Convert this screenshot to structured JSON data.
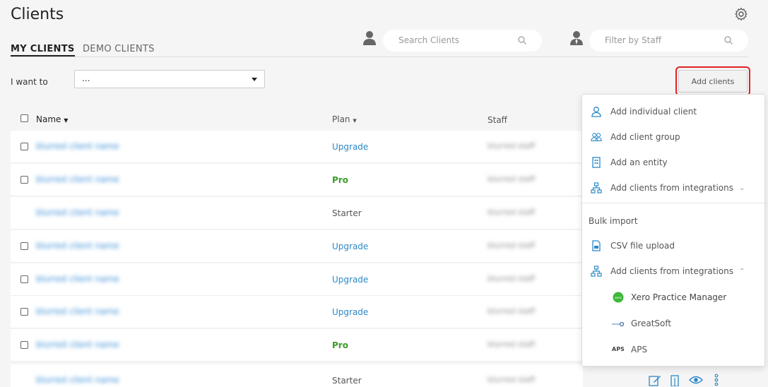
{
  "page": {
    "title": "Clients"
  },
  "tabs": [
    {
      "label": "MY CLIENTS",
      "active": true
    },
    {
      "label": "DEMO CLIENTS",
      "active": false
    }
  ],
  "search": {
    "placeholder": "Search Clients"
  },
  "staff_filter": {
    "placeholder": "Filter by Staff"
  },
  "toolbar": {
    "i_want_to_label": "I want to",
    "i_want_to_value": "...",
    "add_clients_label": "Add clients"
  },
  "table": {
    "columns": {
      "name": "Name",
      "plan": "Plan",
      "staff": "Staff"
    },
    "rows": [
      {
        "name": "blurred client name",
        "plan": "Upgrade",
        "staff": "blurred staff",
        "checkbox": true
      },
      {
        "name": "blurred client name",
        "plan": "Pro",
        "staff": "blurred staff",
        "checkbox": true
      },
      {
        "name": "blurred client name",
        "plan": "Starter",
        "staff": "blurred staff",
        "checkbox": false
      },
      {
        "name": "blurred client name",
        "plan": "Upgrade",
        "staff": "blurred staff",
        "checkbox": true
      },
      {
        "name": "blurred client name",
        "plan": "Upgrade",
        "staff": "blurred staff",
        "checkbox": true
      },
      {
        "name": "blurred client name",
        "plan": "Upgrade",
        "staff": "blurred staff",
        "checkbox": true
      },
      {
        "name": "blurred client name",
        "plan": "Pro",
        "staff": "blurred staff",
        "checkbox": true
      },
      {
        "name": "blurred client name",
        "plan": "Starter",
        "staff": "blurred staff",
        "checkbox": false
      }
    ]
  },
  "add_menu": {
    "items": [
      {
        "label": "Add individual client",
        "icon": "person-icon"
      },
      {
        "label": "Add client group",
        "icon": "group-icon"
      },
      {
        "label": "Add an entity",
        "icon": "building-icon"
      },
      {
        "label": "Add clients from integrations",
        "icon": "integration-icon",
        "expanded": false
      }
    ],
    "bulk_section": "Bulk import",
    "bulk_items": [
      {
        "label": "CSV file upload",
        "icon": "csv-file-icon"
      },
      {
        "label": "Add clients from integrations",
        "icon": "integration-icon",
        "expanded": true
      }
    ],
    "integrations": [
      {
        "label": "Xero Practice Manager",
        "icon": "xero-logo-icon"
      },
      {
        "label": "GreatSoft",
        "icon": "greatsoft-logo-icon"
      },
      {
        "label": "APS",
        "icon": "aps-logo-icon",
        "badge": "APS"
      }
    ]
  },
  "colors": {
    "accent_link": "#2a88c8",
    "pro_green": "#3c9b2a",
    "highlight_red": "#e32222"
  }
}
